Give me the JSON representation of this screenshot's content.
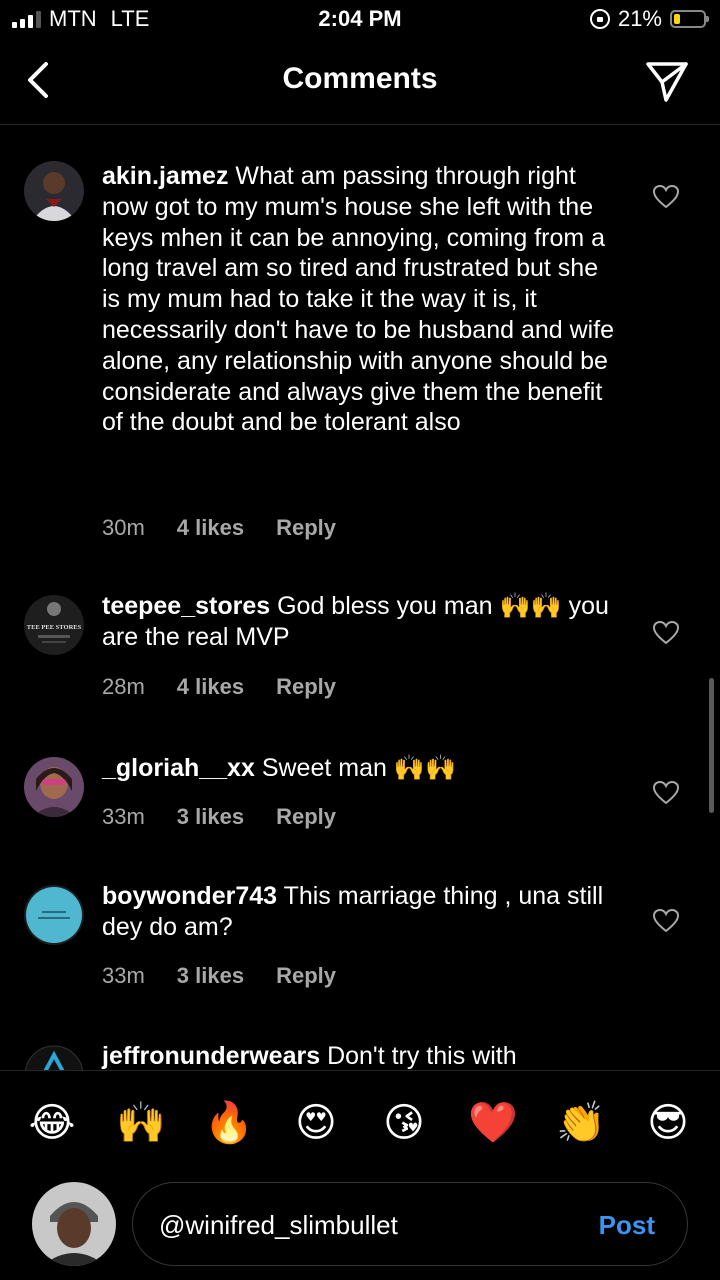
{
  "status_bar": {
    "carrier": "MTN",
    "network": "LTE",
    "time": "2:04 PM",
    "battery_percent": "21%",
    "battery_level": 0.21
  },
  "header": {
    "title": "Comments",
    "back_icon": "chevron-left-icon",
    "send_icon": "paper-plane-icon"
  },
  "comments": [
    {
      "username": "akin.jamez",
      "text": "What am passing through right now got to my mum's house she left with the keys mhen it can be annoying, coming from a long travel am so tired and frustrated but she is my mum had to take it the way it is, it necessarily don't have to be husband and wife alone, any relationship with anyone should be considerate and always give them the benefit of the doubt and be tolerant also",
      "time": "30m",
      "likes": "4 likes",
      "reply": "Reply"
    },
    {
      "username": "teepee_stores",
      "text": "God bless you man 🙌🙌 you are the real MVP",
      "time": "28m",
      "likes": "4 likes",
      "reply": "Reply",
      "avatar_text": "TEE PEE STORES"
    },
    {
      "username": "_gloriah__xx",
      "text": "Sweet man 🙌🙌",
      "time": "33m",
      "likes": "3 likes",
      "reply": "Reply"
    },
    {
      "username": "boywonder743",
      "text": "This marriage thing , una still dey do am?",
      "time": "33m",
      "likes": "3 likes",
      "reply": "Reply"
    },
    {
      "username": "jeffronunderwears",
      "text": "Don't try this with"
    }
  ],
  "emoji_bar": [
    "😂",
    "🙌",
    "🔥",
    "😍",
    "😘",
    "❤️",
    "👏",
    "😎"
  ],
  "composer": {
    "value": "@winifred_slimbullet",
    "post_label": "Post"
  },
  "colors": {
    "background": "#000000",
    "secondary_text": "#a8a8a8",
    "post_blue": "#3b93f3",
    "divider": "#262626"
  }
}
